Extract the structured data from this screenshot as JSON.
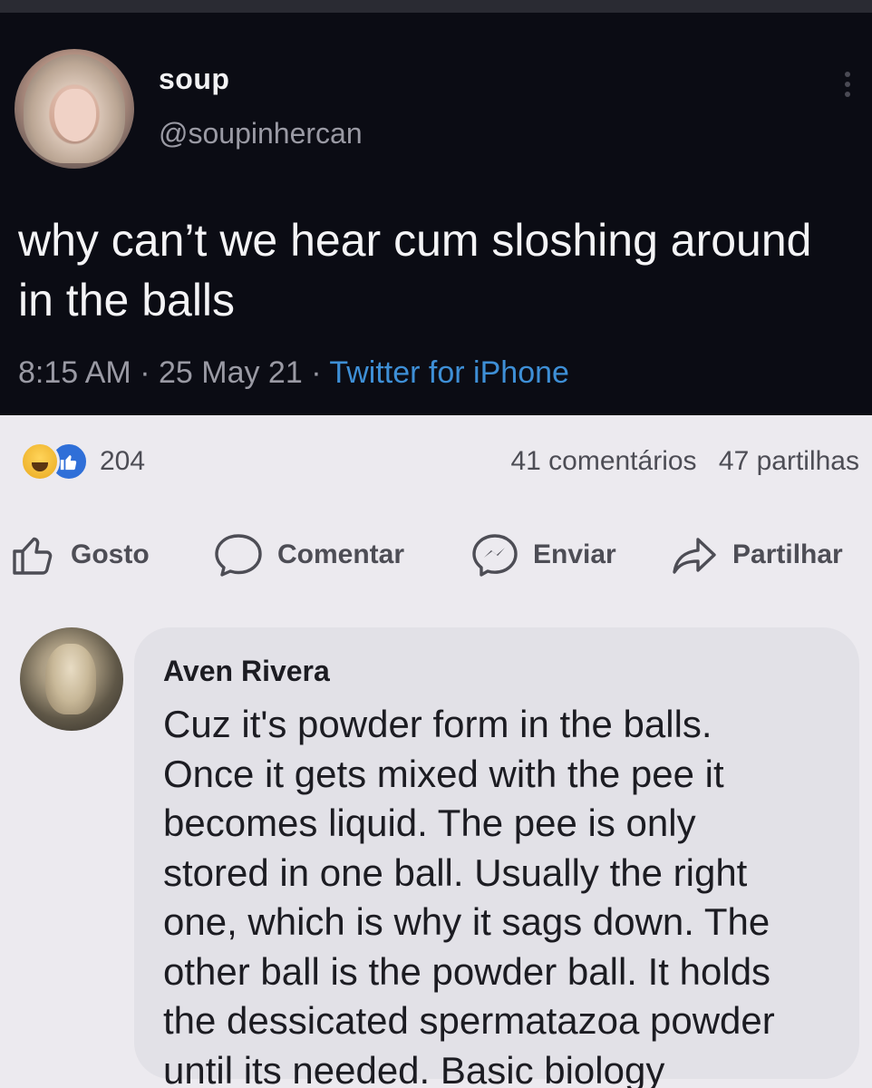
{
  "tweet": {
    "display_name": "soup",
    "handle": "@soupinhercan",
    "text": "why can’t we hear cum sloshing around in the balls",
    "time": "8:15 AM",
    "date": "25 May 21",
    "source": "Twitter for iPhone"
  },
  "reactions": {
    "count": "204",
    "icons": [
      "haha-icon",
      "like-icon"
    ],
    "comments_label": "41 comentários",
    "shares_label": "47 partilhas"
  },
  "actions": {
    "like_label": "Gosto",
    "comment_label": "Comentar",
    "send_label": "Enviar",
    "share_label": "Partilhar"
  },
  "comment": {
    "author": "Aven Rivera",
    "lines": [
      "Cuz it's powder form in the balls.",
      "Once it gets mixed with the pee it",
      "becomes liquid. The pee is only",
      "stored in one ball. Usually the right",
      "one, which is why it sags down. The",
      "other ball is the powder ball. It holds",
      "the dessicated spermatazoa powder",
      "until its needed. Basic biology"
    ]
  },
  "colors": {
    "tweet_bg": "#0b0c14",
    "page_bg": "#eceaef",
    "source_link": "#3e8fd6",
    "bubble_bg": "#e2e1e7",
    "like_blue": "#2f6fd8"
  }
}
